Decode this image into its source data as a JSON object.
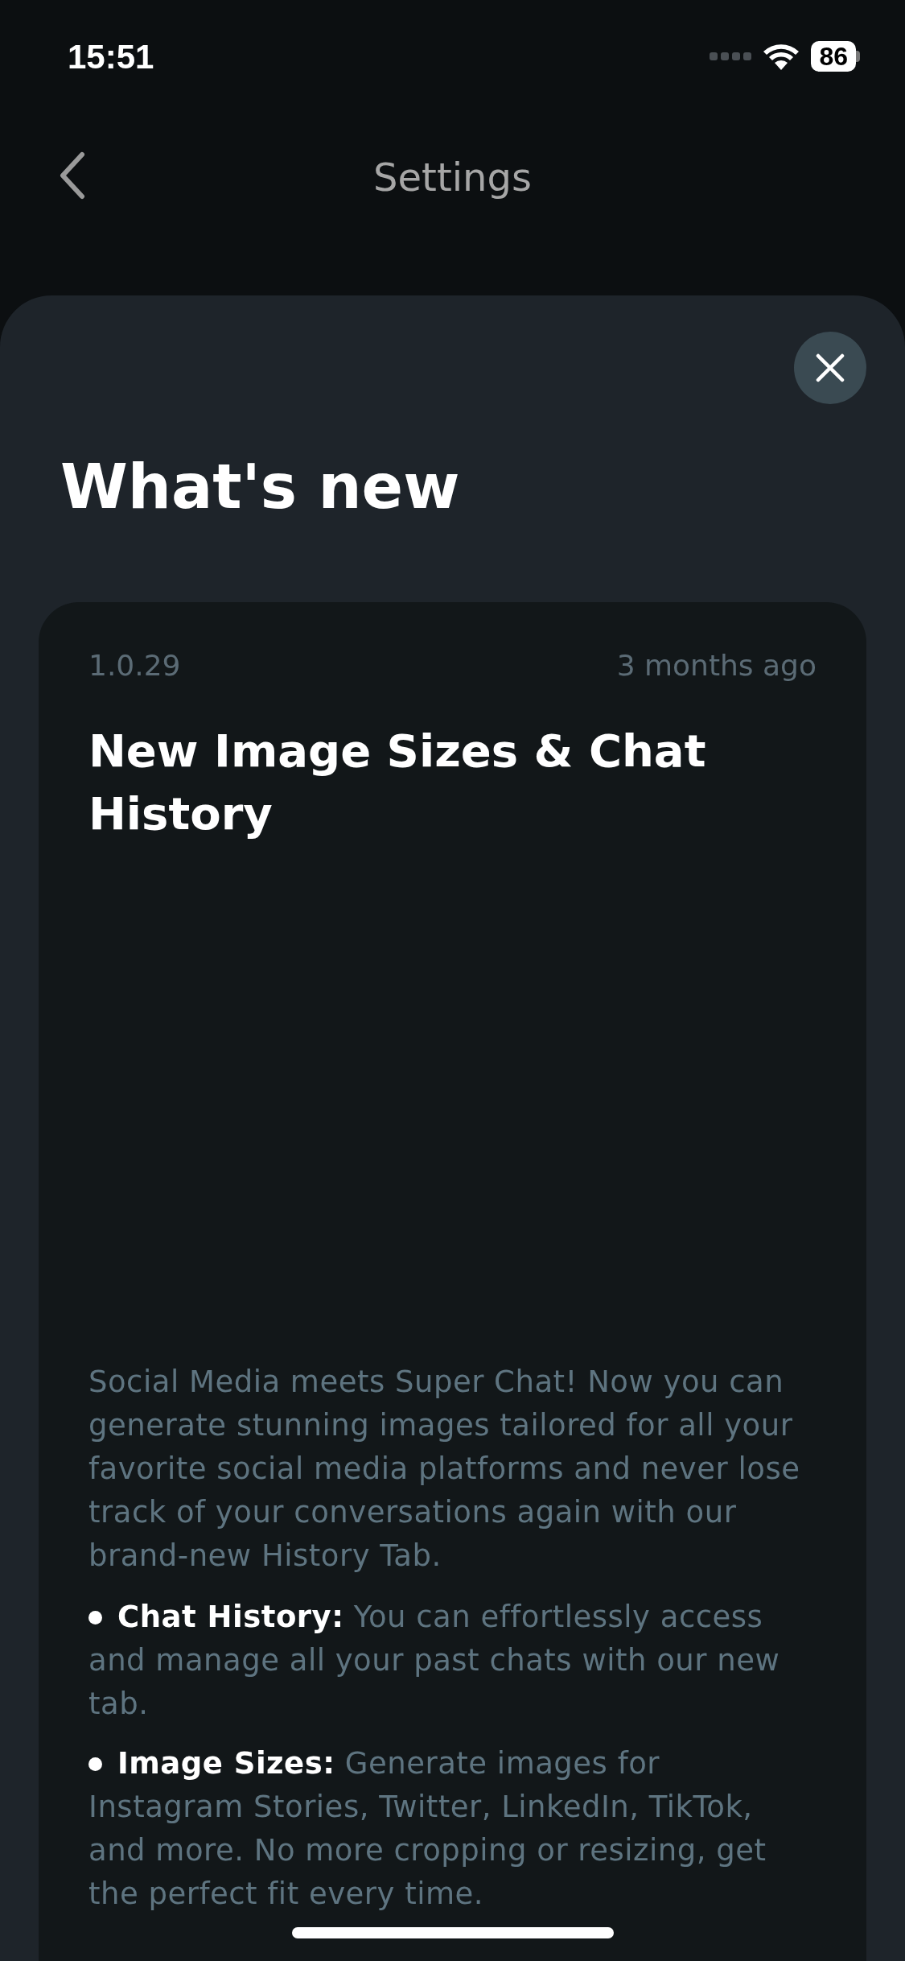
{
  "status_bar": {
    "time": "15:51",
    "battery": "86"
  },
  "nav": {
    "title": "Settings"
  },
  "sheet": {
    "title": "What's new",
    "release": {
      "version": "1.0.29",
      "date": "3 months ago",
      "title": "New Image Sizes & Chat History",
      "intro": "Social Media meets Super Chat! Now you can generate stunning images tailored for all your favorite social media platforms and never lose track of your conversations again with our brand-new History Tab.",
      "bullets": [
        "**Chat History:** You can effortlessly access and manage all your past chats with our new tab.",
        "**Image Sizes:** Generate images for Instagram Stories, Twitter, LinkedIn, TikTok, and more. No more cropping or resizing, get the perfect fit every time."
      ]
    }
  }
}
